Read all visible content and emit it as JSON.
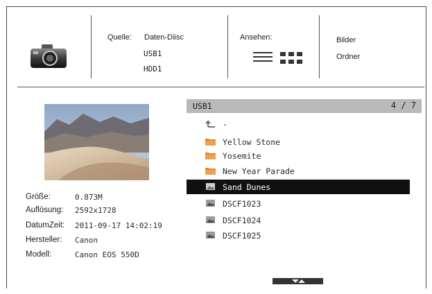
{
  "header": {
    "source_label": "Quelle:",
    "sources": [
      "Daten-Diisc",
      "USB1",
      "HDD1"
    ],
    "view_label": "Ansehen:",
    "view_options": [
      "Bilder",
      "Ordner"
    ]
  },
  "info": {
    "fields": [
      {
        "label": "Größe:",
        "value": "0.873M"
      },
      {
        "label": "Auflösung:",
        "value": "2592x1728"
      },
      {
        "label": "DatumZeit:",
        "value": "2011-09-17 14:02:19"
      },
      {
        "label": "Hersteller:",
        "value": "Canon"
      },
      {
        "label": "Modell:",
        "value": "Canon EOS 550D"
      }
    ]
  },
  "browser": {
    "path": "USB1",
    "page": "4 / 7",
    "up_label": "-",
    "items": [
      {
        "name": "Yellow Stone",
        "icon": "folder-icon"
      },
      {
        "name": "Yosemite",
        "icon": "folder-icon"
      },
      {
        "name": "New Year Parade",
        "icon": "folder-icon"
      },
      {
        "name": "Sand Dunes",
        "icon": "photo-file-icon",
        "selected": true
      },
      {
        "name": "DSCF1023",
        "icon": "photo-file-icon"
      },
      {
        "name": "DSCF1024",
        "icon": "photo-file-icon"
      },
      {
        "name": "DSCF1025",
        "icon": "photo-file-icon"
      }
    ]
  },
  "colors": {
    "path_bar": "#b9b9b9",
    "selection": "#111111",
    "folder": "#e0873a"
  }
}
